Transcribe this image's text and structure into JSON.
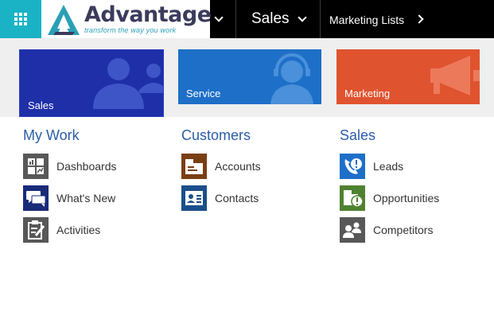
{
  "topbar": {
    "logo": {
      "word": "Advantage",
      "tagline": "transform the way you work"
    },
    "module": "Sales",
    "breadcrumb": "Marketing Lists"
  },
  "tiles": [
    {
      "label": "Sales",
      "color": "#1e2fa8"
    },
    {
      "label": "Service",
      "color": "#1e6fc8"
    },
    {
      "label": "Marketing",
      "color": "#e0532f"
    }
  ],
  "sections": [
    {
      "title": "My Work",
      "items": [
        {
          "label": "Dashboards",
          "icon": "dashboards-icon"
        },
        {
          "label": "What's New",
          "icon": "whats-new-icon"
        },
        {
          "label": "Activities",
          "icon": "activities-icon"
        }
      ]
    },
    {
      "title": "Customers",
      "items": [
        {
          "label": "Accounts",
          "icon": "accounts-icon"
        },
        {
          "label": "Contacts",
          "icon": "contacts-icon"
        }
      ]
    },
    {
      "title": "Sales",
      "items": [
        {
          "label": "Leads",
          "icon": "leads-icon"
        },
        {
          "label": "Opportunities",
          "icon": "opportunities-icon"
        },
        {
          "label": "Competitors",
          "icon": "competitors-icon"
        }
      ]
    }
  ],
  "colors": {
    "accent": "#19b3c5",
    "section_title": "#2b5ea8"
  }
}
